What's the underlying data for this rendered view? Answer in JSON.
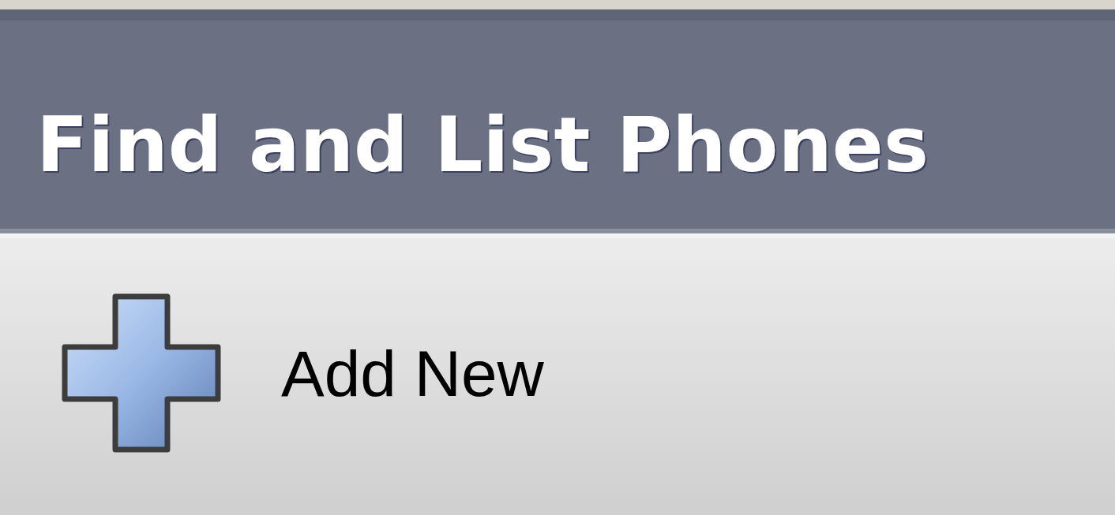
{
  "header": {
    "title": "Find and List Phones"
  },
  "toolbar": {
    "buttons": [
      {
        "kind": "add",
        "label": "Add New"
      }
    ]
  }
}
